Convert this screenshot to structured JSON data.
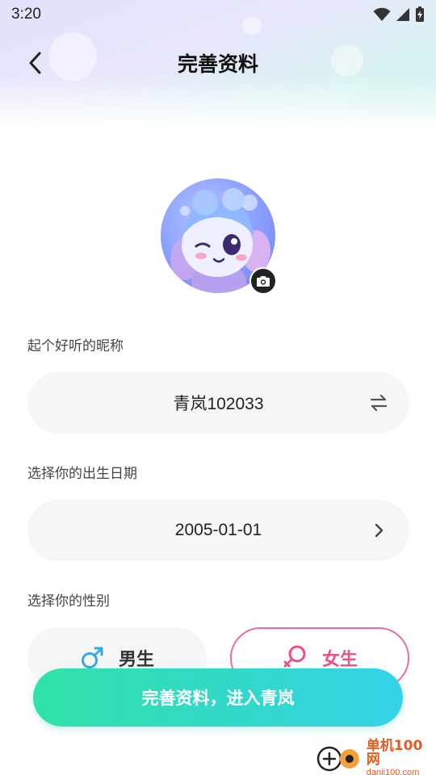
{
  "status_bar": {
    "time": "3:20",
    "icons": [
      "wifi-icon",
      "signal-icon",
      "battery-charging-icon"
    ]
  },
  "header": {
    "title": "完善资料",
    "back_icon": "chevron-left-icon"
  },
  "avatar": {
    "camera_icon": "camera-icon"
  },
  "nickname": {
    "label": "起个好听的昵称",
    "value": "青岚102033",
    "icon": "swap-icon"
  },
  "birthday": {
    "label": "选择你的出生日期",
    "value": "2005-01-01",
    "icon": "chevron-right-icon"
  },
  "gender": {
    "label": "选择你的性别",
    "options": [
      {
        "label": "男生",
        "icon": "male-icon",
        "selected": false
      },
      {
        "label": "女生",
        "icon": "female-icon",
        "selected": true
      }
    ]
  },
  "submit": {
    "label": "完善资料，进入青岚"
  },
  "watermark": {
    "title": "单机100网",
    "url": "danji100.com"
  },
  "colors": {
    "accent_start": "#2fe3a8",
    "accent_end": "#35d3e8",
    "female": "#ee4f88",
    "male": "#3aa6e8"
  }
}
